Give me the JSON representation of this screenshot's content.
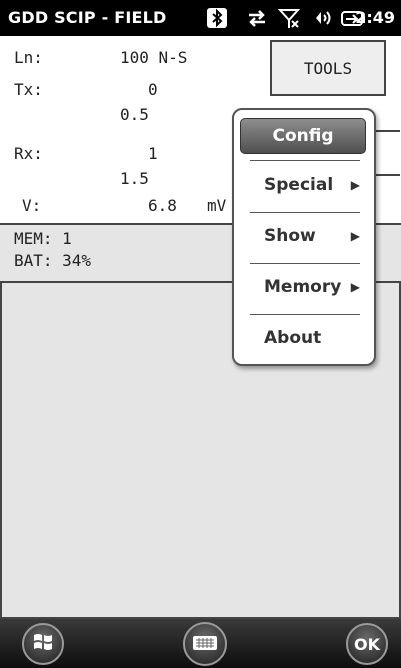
{
  "status_bar": {
    "title": "GDD SCIP - FIELD",
    "time": "2:49",
    "icons": [
      "bluetooth-icon",
      "data-sync-icon",
      "no-signal-icon",
      "volume-icon",
      "battery-charging-icon"
    ]
  },
  "readings": {
    "ln": {
      "label": "Ln:",
      "value": "100 N-S"
    },
    "tx": {
      "label": "Tx:",
      "value1": "0",
      "value2": "0.5"
    },
    "rx": {
      "label": "Rx:",
      "value1": "1",
      "value2": "1.5"
    },
    "v": {
      "label": "V:",
      "value": "6.8",
      "unit": "mV"
    }
  },
  "tools_button": {
    "label": "TOOLS"
  },
  "info": {
    "mem": "MEM: 1",
    "bat": "BAT: 34%"
  },
  "menu": {
    "items": [
      {
        "label": "Config",
        "selected": true,
        "submenu": false
      },
      {
        "label": "Special",
        "selected": false,
        "submenu": true
      },
      {
        "label": "Show",
        "selected": false,
        "submenu": true
      },
      {
        "label": "Memory",
        "selected": false,
        "submenu": true
      },
      {
        "label": "About",
        "selected": false,
        "submenu": false
      }
    ]
  },
  "taskbar": {
    "start_icon": "windows-logo-icon",
    "keyboard_icon": "keyboard-icon",
    "ok_label": "OK"
  }
}
